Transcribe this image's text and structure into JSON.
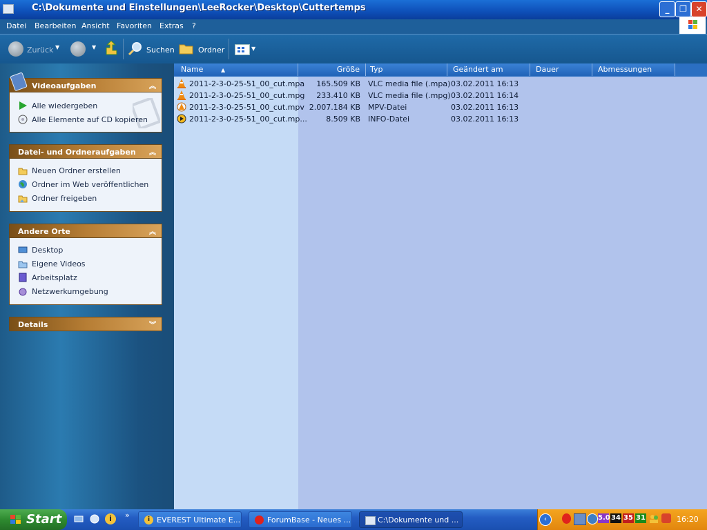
{
  "window": {
    "title": "C:\\Dokumente und Einstellungen\\LeeRocker\\Desktop\\Cuttertemps"
  },
  "menu": [
    "Datei",
    "Bearbeiten",
    "Ansicht",
    "Favoriten",
    "Extras",
    "?"
  ],
  "toolbar": {
    "back_label": "Zurück",
    "search_label": "Suchen",
    "folders_label": "Ordner"
  },
  "panels": {
    "video": {
      "title": "Videoaufgaben",
      "items": [
        "Alle wiedergeben",
        "Alle Elemente auf CD kopieren"
      ]
    },
    "file": {
      "title": "Datei- und Ordneraufgaben",
      "items": [
        "Neuen Ordner erstellen",
        "Ordner im Web veröffentlichen",
        "Ordner freigeben"
      ]
    },
    "places": {
      "title": "Andere Orte",
      "items": [
        "Desktop",
        "Eigene Videos",
        "Arbeitsplatz",
        "Netzwerkumgebung"
      ]
    },
    "details": {
      "title": "Details"
    }
  },
  "columns": [
    "Name",
    "Größe",
    "Typ",
    "Geändert am",
    "Dauer",
    "Abmessungen"
  ],
  "files": [
    {
      "name": "2011-2-3-0-25-51_00_cut.mpa",
      "size": "165.509 KB",
      "type": "VLC media file (.mpa)",
      "modified": "03.02.2011 16:13",
      "icon": "vlc-cone-icon"
    },
    {
      "name": "2011-2-3-0-25-51_00_cut.mpg",
      "size": "233.410 KB",
      "type": "VLC media file (.mpg)",
      "modified": "03.02.2011 16:14",
      "icon": "vlc-cone-icon"
    },
    {
      "name": "2011-2-3-0-25-51_00_cut.mpv",
      "size": "2.007.184 KB",
      "type": "MPV-Datei",
      "modified": "03.02.2011 16:13",
      "icon": "mpv-icon"
    },
    {
      "name": "2011-2-3-0-25-51_00_cut.mp...",
      "size": "8.509 KB",
      "type": "INFO-Datei",
      "modified": "03.02.2011 16:13",
      "icon": "media-player-icon"
    }
  ],
  "taskbar": {
    "start_label": "Start",
    "buttons": [
      "EVEREST Ultimate E...",
      "ForumBase - Neues ...",
      "C:\\Dokumente und ..."
    ],
    "tray_numbers": [
      "5.0",
      "34",
      "35",
      "31"
    ],
    "clock": "16:20"
  },
  "colors": {
    "accent": "#245dc3",
    "start": "#2e8a30",
    "panel_head": "#b67d34",
    "tray": "#e2860e"
  }
}
